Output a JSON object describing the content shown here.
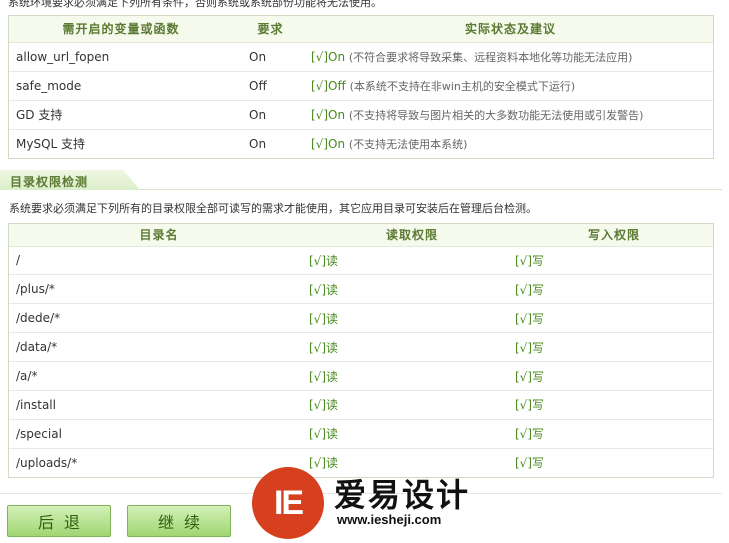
{
  "top_note": "系统环境要求必须满足下列所有条件，否则系统或系统部份功能将无法使用。",
  "env_table": {
    "headers": [
      "需开启的变量或函数",
      "要求",
      "实际状态及建议"
    ],
    "rows": [
      {
        "name": "allow_url_fopen",
        "req": "On",
        "status": "[√]On",
        "note": "(不符合要求将导致采集、远程资料本地化等功能无法应用)"
      },
      {
        "name": "safe_mode",
        "req": "Off",
        "status": "[√]Off",
        "note": "(本系统不支持在非win主机的安全模式下运行)"
      },
      {
        "name": "GD 支持",
        "req": "On",
        "status": "[√]On",
        "note": "(不支持将导致与图片相关的大多数功能无法使用或引发警告)"
      },
      {
        "name": "MySQL 支持",
        "req": "On",
        "status": "[√]On",
        "note": "(不支持无法使用本系统)"
      }
    ]
  },
  "section_title": "目录权限检测",
  "desc": "系统要求必须满足下列所有的目录权限全部可读写的需求才能使用，其它应用目录可安装后在管理后台检测。",
  "dir_table": {
    "headers": [
      "目录名",
      "读取权限",
      "写入权限"
    ],
    "rows": [
      {
        "dir": "/",
        "read": "[√]读",
        "write": "[√]写"
      },
      {
        "dir": "/plus/*",
        "read": "[√]读",
        "write": "[√]写"
      },
      {
        "dir": "/dede/*",
        "read": "[√]读",
        "write": "[√]写"
      },
      {
        "dir": "/data/*",
        "read": "[√]读",
        "write": "[√]写"
      },
      {
        "dir": "/a/*",
        "read": "[√]读",
        "write": "[√]写"
      },
      {
        "dir": "/install",
        "read": "[√]读",
        "write": "[√]写"
      },
      {
        "dir": "/special",
        "read": "[√]读",
        "write": "[√]写"
      },
      {
        "dir": "/uploads/*",
        "read": "[√]读",
        "write": "[√]写"
      }
    ]
  },
  "buttons": {
    "back": "后退",
    "next": "继续"
  },
  "watermark": {
    "mark": "IE",
    "name": "爱易设计",
    "url": "www.iesheji.com"
  },
  "colors": {
    "accent_green": "#4a8a1e",
    "button_green": "#9fd673",
    "logo_red": "#d6401f"
  }
}
